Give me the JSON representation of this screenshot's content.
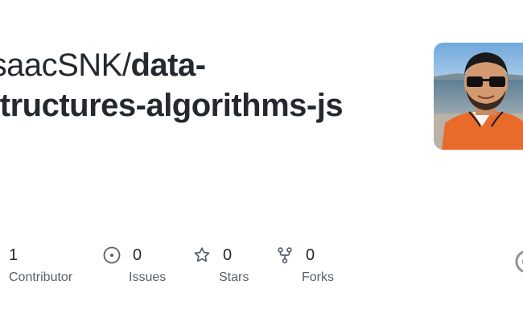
{
  "repo": {
    "owner": "IsaacSNK/",
    "name_line1": "data-",
    "name_line2": "structures-algorithms-js"
  },
  "avatar": {
    "icon": "user-avatar-photo"
  },
  "stats": [
    {
      "value": "1",
      "label": "Contributor",
      "icon": "contributor-icon"
    },
    {
      "value": "0",
      "label": "Issues",
      "icon": "issue-opened-icon"
    },
    {
      "value": "0",
      "label": "Stars",
      "icon": "star-icon"
    },
    {
      "value": "0",
      "label": "Forks",
      "icon": "repo-forked-icon"
    }
  ],
  "colors": {
    "text": "#24292f",
    "muted": "#57606a",
    "icon": "#57606a"
  }
}
